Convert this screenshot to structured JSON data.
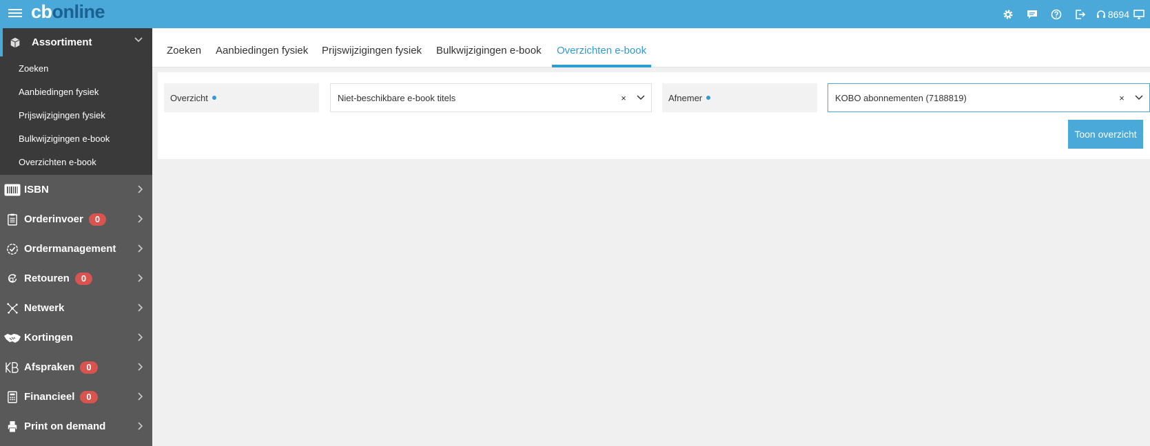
{
  "header": {
    "logo_part1": "cb",
    "logo_part2": "online",
    "support_number": "8694",
    "icons": [
      "menu-icon",
      "gear-icon",
      "chat-icon",
      "help-icon",
      "logout-icon",
      "headset-icon",
      "monitor-icon"
    ],
    "colors": {
      "bar": "#4aa9d8",
      "logo_accent": "#1d5f93"
    }
  },
  "sidebar": {
    "section": {
      "label": "Assortiment",
      "icon": "box-icon",
      "items": [
        {
          "label": "Zoeken"
        },
        {
          "label": "Aanbiedingen fysiek"
        },
        {
          "label": "Prijswijzigingen fysiek"
        },
        {
          "label": "Bulkwijzigingen e-book"
        },
        {
          "label": "Overzichten e-book"
        }
      ]
    },
    "items": [
      {
        "label": "ISBN",
        "icon": "barcode-icon"
      },
      {
        "label": "Orderinvoer",
        "icon": "clipboard-icon",
        "badge": "0"
      },
      {
        "label": "Ordermanagement",
        "icon": "check-circle-icon"
      },
      {
        "label": "Retouren",
        "icon": "return-icon",
        "badge": "0"
      },
      {
        "label": "Netwerk",
        "icon": "network-icon"
      },
      {
        "label": "Kortingen",
        "icon": "handshake-icon"
      },
      {
        "label": "Afspraken",
        "icon": "kb-icon",
        "badge": "0"
      },
      {
        "label": "Financieel",
        "icon": "calculator-icon",
        "badge": "0"
      },
      {
        "label": "Print on demand",
        "icon": "printer-icon"
      }
    ],
    "colors": {
      "bg": "#595959",
      "section_bg": "#3a3a3a",
      "badge": "#d9534f"
    }
  },
  "tabs": [
    {
      "label": "Zoeken"
    },
    {
      "label": "Aanbiedingen fysiek"
    },
    {
      "label": "Prijswijzigingen fysiek"
    },
    {
      "label": "Bulkwijzigingen e-book"
    },
    {
      "label": "Overzichten e-book",
      "active": true
    }
  ],
  "form": {
    "overzicht_label": "Overzicht",
    "overzicht_value": "Niet-beschikbare e-book titels",
    "afnemer_label": "Afnemer",
    "afnemer_value": "KOBO abonnementen (7188819)",
    "clear_symbol": "×",
    "submit_label": "Toon overzicht",
    "colors": {
      "accent": "#2f9bd3"
    }
  }
}
